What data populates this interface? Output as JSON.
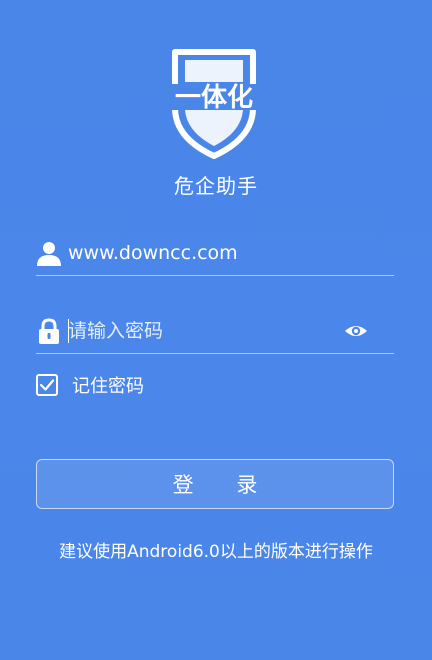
{
  "app": {
    "logo_text": "一体化",
    "name": "危企助手"
  },
  "login_form": {
    "username_value": "www.downcc.com",
    "password_placeholder": "请输入密码",
    "remember_label": "记住密码",
    "remember_checked": true,
    "submit_label": "登 录"
  },
  "hint": "建议使用Android6.0以上的版本进行操作",
  "icons": {
    "username": "user-icon",
    "password": "lock-icon",
    "toggle_password": "eye-icon",
    "remember": "checkmark-icon"
  },
  "colors": {
    "background": "#4a86e8",
    "text": "#ffffff"
  }
}
